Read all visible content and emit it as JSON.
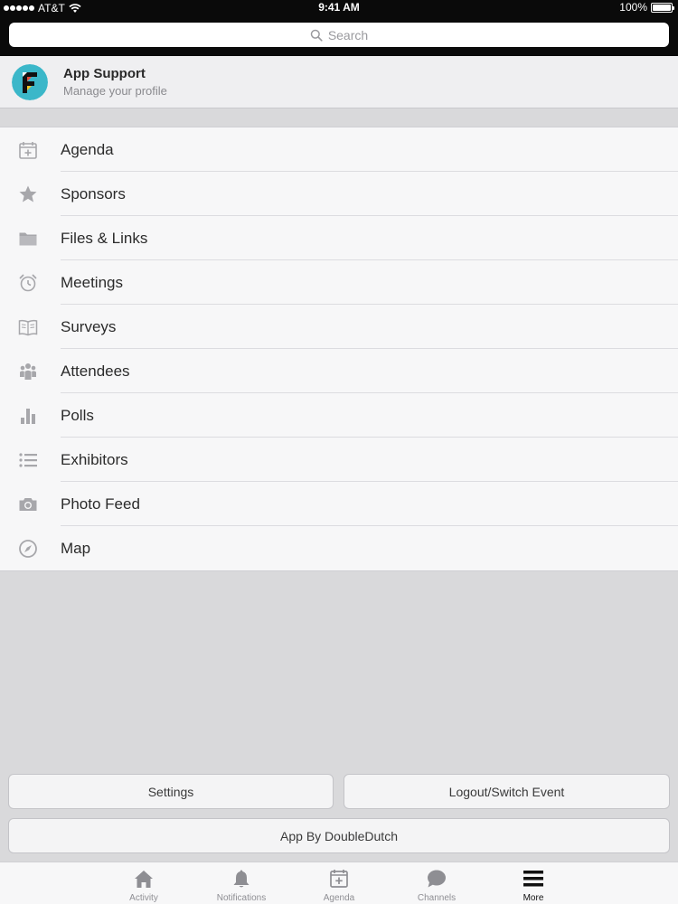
{
  "status_bar": {
    "carrier": "AT&T",
    "time": "9:41 AM",
    "battery": "100%"
  },
  "search": {
    "placeholder": "Search"
  },
  "profile": {
    "name": "App Support",
    "subtitle": "Manage your profile"
  },
  "menu": {
    "items": [
      {
        "label": "Agenda",
        "icon": "calendar-plus-icon"
      },
      {
        "label": "Sponsors",
        "icon": "star-icon"
      },
      {
        "label": "Files & Links",
        "icon": "folder-icon"
      },
      {
        "label": "Meetings",
        "icon": "alarm-clock-icon"
      },
      {
        "label": "Surveys",
        "icon": "book-icon"
      },
      {
        "label": "Attendees",
        "icon": "people-icon"
      },
      {
        "label": "Polls",
        "icon": "bar-chart-icon"
      },
      {
        "label": "Exhibitors",
        "icon": "list-icon"
      },
      {
        "label": "Photo Feed",
        "icon": "camera-icon"
      },
      {
        "label": "Map",
        "icon": "compass-icon"
      }
    ]
  },
  "buttons": {
    "settings": "Settings",
    "logout": "Logout/Switch Event",
    "app_by": "App By DoubleDutch"
  },
  "tabbar": {
    "tabs": [
      {
        "label": "Activity",
        "icon": "home-icon"
      },
      {
        "label": "Notifications",
        "icon": "bell-icon"
      },
      {
        "label": "Agenda",
        "icon": "calendar-plus-icon"
      },
      {
        "label": "Channels",
        "icon": "chat-bubble-icon"
      },
      {
        "label": "More",
        "icon": "hamburger-menu-icon",
        "active": true
      }
    ]
  },
  "colors": {
    "header_bg": "#0a0a0a",
    "page_bg": "#d9d9db",
    "icon_gray": "#a7a7ab",
    "active_tab": "#111111"
  }
}
